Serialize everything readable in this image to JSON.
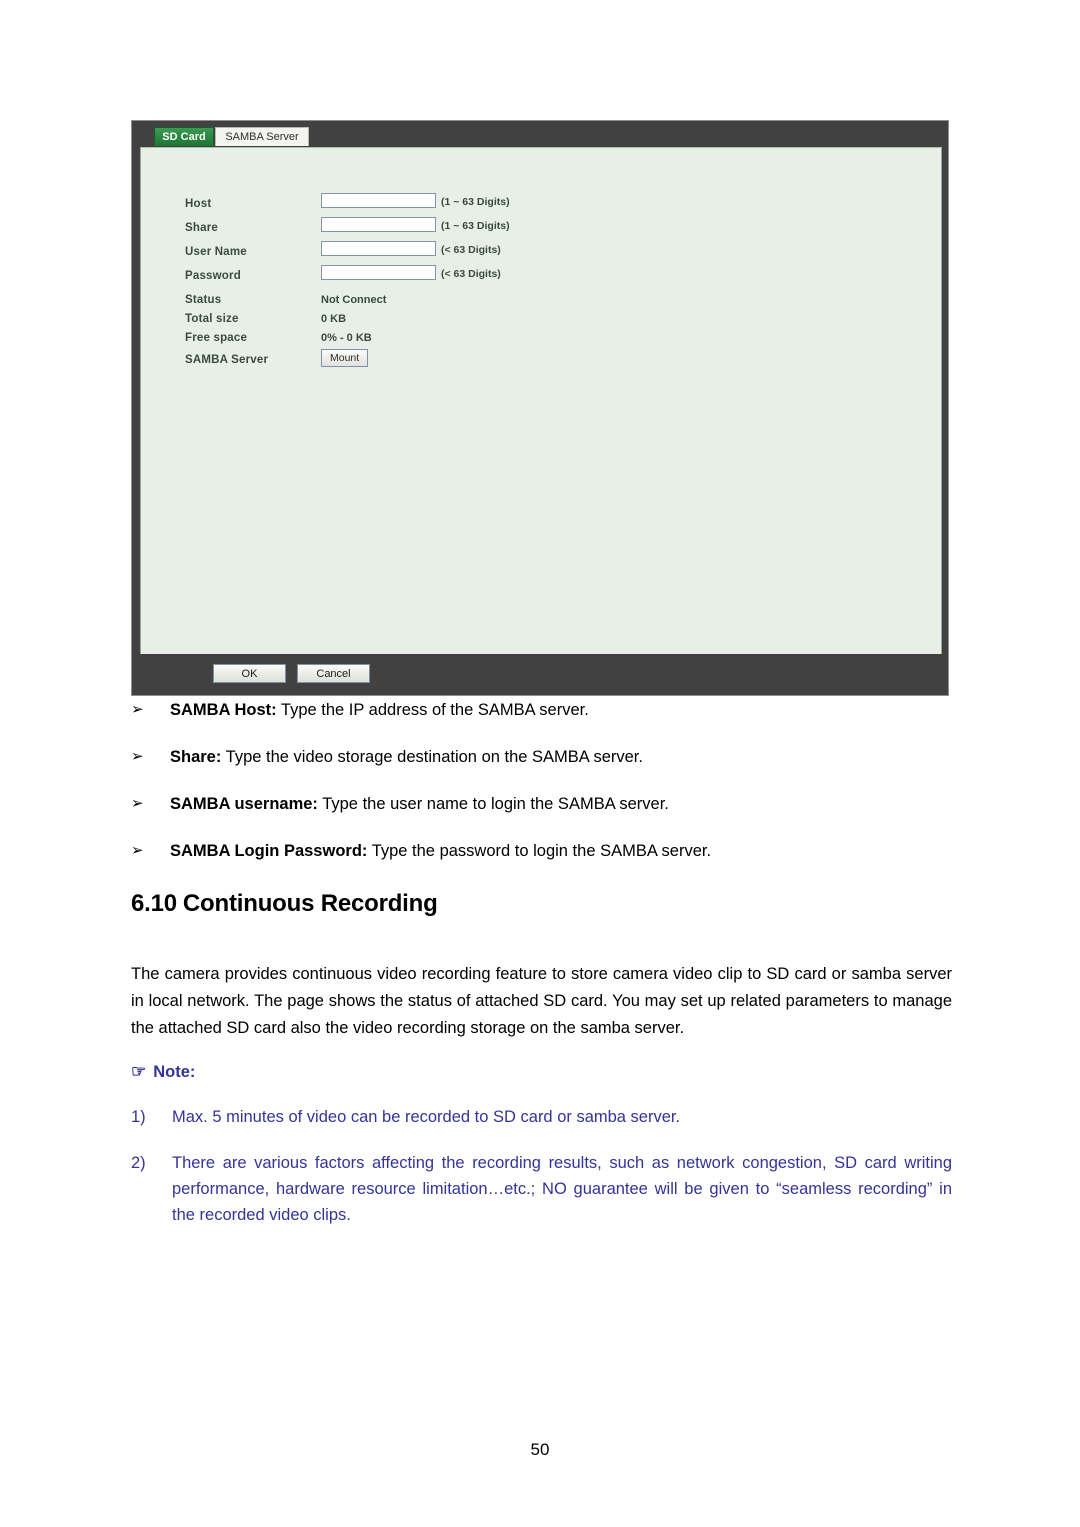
{
  "figure": {
    "tabs": [
      {
        "label": "SD Card",
        "active": true
      },
      {
        "label": "SAMBA Server",
        "active": false
      }
    ],
    "form": {
      "rows": [
        {
          "label": "Host",
          "type": "input",
          "value": "",
          "hint": "(1 ~ 63 Digits)"
        },
        {
          "label": "Share",
          "type": "input",
          "value": "",
          "hint": "(1 ~ 63 Digits)"
        },
        {
          "label": "User Name",
          "type": "input",
          "value": "",
          "hint": "(< 63 Digits)"
        },
        {
          "label": "Password",
          "type": "input",
          "value": "",
          "hint": "(< 63 Digits)"
        },
        {
          "label": "Status",
          "type": "text",
          "value": "Not Connect"
        },
        {
          "label": "Total size",
          "type": "text",
          "value": "0 KB"
        },
        {
          "label": "Free space",
          "type": "text",
          "value": "0% - 0 KB"
        },
        {
          "label": "SAMBA Server",
          "type": "button",
          "value": "Mount"
        }
      ]
    },
    "footer": {
      "ok_label": "OK",
      "cancel_label": "Cancel"
    },
    "colors": {
      "frame": "#414141",
      "panel_bg": "#e7efe6",
      "active_tab": "#2a8040",
      "input_border": "#8094a6"
    }
  },
  "bullets": [
    {
      "marker": "➢",
      "term": "SAMBA Host:",
      "text": " Type the IP address of the SAMBA server."
    },
    {
      "marker": "➢",
      "term": "Share:",
      "text": " Type the video storage destination on the SAMBA server."
    },
    {
      "marker": "➢",
      "term": "SAMBA username:",
      "text": " Type the user name to login the SAMBA server."
    },
    {
      "marker": "➢",
      "term": "SAMBA Login Password:",
      "text": " Type the password to login the SAMBA server."
    }
  ],
  "section": {
    "number": "6.10",
    "title": "Continuous Recording"
  },
  "paragraph": "The camera provides continuous video recording feature to store camera video clip to SD card or samba server in local network. The page shows the status of attached SD card. You may set up related parameters to manage the attached SD card also the video recording storage on the samba server.",
  "note": {
    "icon": "☞",
    "title": "Note:",
    "color": "#33339a",
    "items": [
      {
        "marker": "1)",
        "text": "Max. 5 minutes of video can be recorded to SD card or samba server."
      },
      {
        "marker": "2)",
        "text": "There are various factors affecting the recording results, such as network congestion, SD card writing performance, hardware resource limitation…etc.; NO guarantee will be given to “seamless recording” in the recorded video clips."
      }
    ]
  },
  "page_number": "50"
}
